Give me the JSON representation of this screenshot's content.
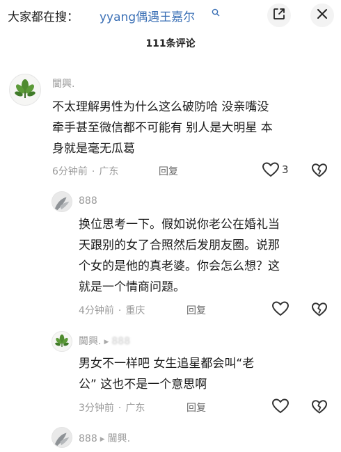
{
  "header": {
    "search_prefix": "大家都在搜：",
    "search_query": "yyang偶遇王嘉尔",
    "comment_count": "111条评论"
  },
  "icons": {
    "search_query_icon": "search-icon",
    "fullscreen_button_icon": "expand-square-icon",
    "close_button_icon": "close-icon",
    "like_icon": "heart-icon",
    "dislike_icon": "broken-heart-icon",
    "reply_arrow_icon": "triangle-right-icon"
  },
  "comments": [
    {
      "username": "閫興.",
      "text_line1": "不太理解男性为什么这么破防哈 没亲嘴没",
      "text_line2": "牵手甚至微信都不可能有 别人是大明星 本",
      "text_line3": "身就是毫无瓜葛",
      "time": "6分钟前",
      "separator": "·",
      "location": "广东",
      "reply_label": "回复",
      "like_count": "3"
    },
    {
      "username": "888",
      "text_line1": "换位思考一下。假如说你老公在婚礼当",
      "text_line2": "天跟别的女了合照然后发朋友圈。说那",
      "text_line3": "个女的是他的真老婆。你会怎么想？这",
      "text_line4": "就是一个情商问题。",
      "time": "4分钟前",
      "separator": "·",
      "location": "重庆",
      "reply_label": "回复"
    },
    {
      "username": "閫興.",
      "reply_arrow": "▶",
      "reply_to": "888",
      "text_line1": "男女不一样吧 女生追星都会叫“老",
      "text_line2": "公” 这也不是一个意思啊",
      "time": "3分钟前",
      "separator": "·",
      "location": "广东",
      "reply_label": "回复"
    },
    {
      "username": "888",
      "reply_arrow": "▶",
      "reply_to": "閫興."
    }
  ],
  "colors": {
    "link_blue": "#3a6fb5",
    "meta_gray": "#9a9a9a",
    "text_dark": "#1b1b1b"
  }
}
